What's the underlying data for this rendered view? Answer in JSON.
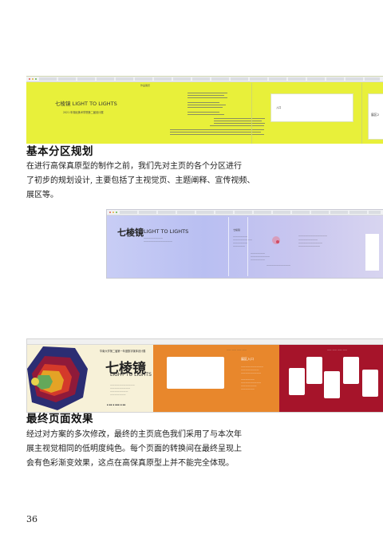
{
  "shot_top": {
    "title": "七棱镜 LIGHT TO LIGHTS",
    "subtitle": "2021 年湖北美术学院第二届设计展",
    "top_label": "作品展览",
    "card_label": "入口",
    "last_card_label": "展区2",
    "colors": {
      "background": "#e8f03a"
    }
  },
  "section1": {
    "heading": "基本分区规划",
    "lines": [
      "在进行高保真原型的制作之前，我们先对主页的各个分区进行",
      "了初步的规划设计, 主要包括了主视觉页、主题阐释、宣传视频、",
      "展区等。"
    ]
  },
  "shot_gradient": {
    "title": "七棱镜",
    "title_en": "LIGHT TO LIGHTS",
    "sub_label": "七棱镜"
  },
  "shot_final": {
    "top_line": "华南大学第二届第一年度数字媒体设计展",
    "title": "七棱镜",
    "title_en": "LIGHT TO LIGHTS",
    "orange_label": "展区入口",
    "colors": {
      "cream": "#f7f1d8",
      "orange": "#e8872c",
      "red": "#a6142a"
    }
  },
  "section2": {
    "heading": "最终页面效果",
    "lines": [
      "经过对方案的多次修改，最终的主页底色我们采用了与本次年",
      "展主视觉相同的低明度纯色。每个页面的转换间在最终呈现上",
      "会有色彩渐变效果，这点在高保真原型上并不能完全体现。"
    ]
  },
  "page_number": "36"
}
